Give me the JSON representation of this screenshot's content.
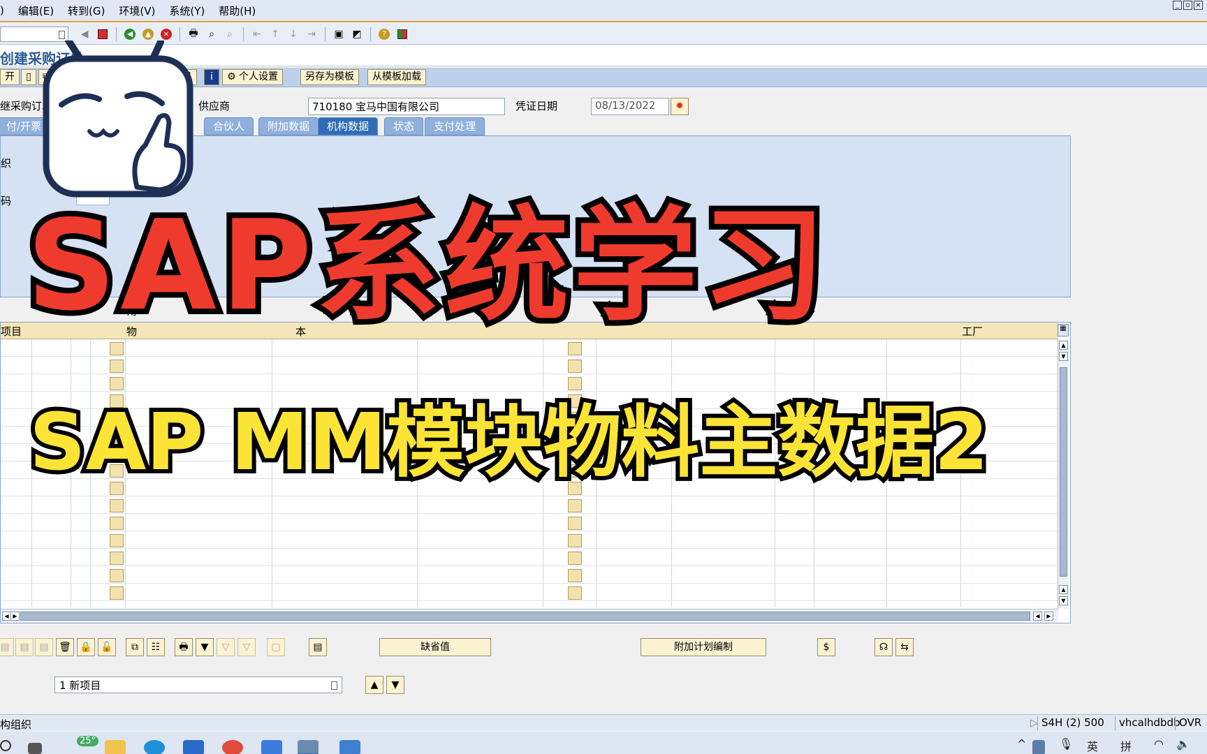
{
  "menu": {
    "items": [
      ")",
      "编辑(E)",
      "转到(G)",
      "环境(V)",
      "系统(Y)",
      "帮助(H)"
    ]
  },
  "title": "创建采购订单",
  "app_toolbar": {
    "buttons": [
      "开",
      "信息",
      "个人设置",
      "另存为模板",
      "从模板加载"
    ]
  },
  "header": {
    "doc_label": "继采购订单",
    "vendor_label": "供应商",
    "vendor_value": "710180 宝马中国有限公司",
    "date_label": "凭证日期",
    "date_value": "08/13/2022"
  },
  "tabs": [
    {
      "label": "付/开票",
      "active": false
    },
    {
      "label": "合伙人",
      "active": false
    },
    {
      "label": "附加数据",
      "active": false
    },
    {
      "label": "机构数据",
      "active": true
    },
    {
      "label": "状态",
      "active": false
    },
    {
      "label": "支付处理",
      "active": false
    }
  ],
  "tab_panel": {
    "label_1": "织",
    "label_2": "码"
  },
  "grid": {
    "headers": [
      "项目",
      "物",
      "本",
      "工厂"
    ],
    "extra_header": "用"
  },
  "bottom_buttons": {
    "default_values": "缺省值",
    "additional_planning": "附加计划编制"
  },
  "item_selector": "1 新项目",
  "status_bar": {
    "message": "构组织",
    "system": "S4H (2) 500",
    "host": "vhcalhdbdb",
    "mode": "OVR"
  },
  "taskbar": {
    "temperature": "25°",
    "ime_1": "英",
    "ime_2": "拼"
  },
  "overlay": {
    "line1": "SAP系统学习",
    "line2": "SAP MM模块物料主数据2"
  },
  "colors": {
    "overlay_red": "#ef3b2d",
    "overlay_yellow": "#fbe436",
    "tab_active": "#2f6bb8",
    "button_bg": "#fbf2d2"
  },
  "icons": [
    "save-icon",
    "back-icon",
    "exit-icon",
    "cancel-icon",
    "print-icon",
    "find-icon",
    "help-icon",
    "calendar-icon",
    "scroll-up-icon",
    "scroll-down-icon"
  ]
}
